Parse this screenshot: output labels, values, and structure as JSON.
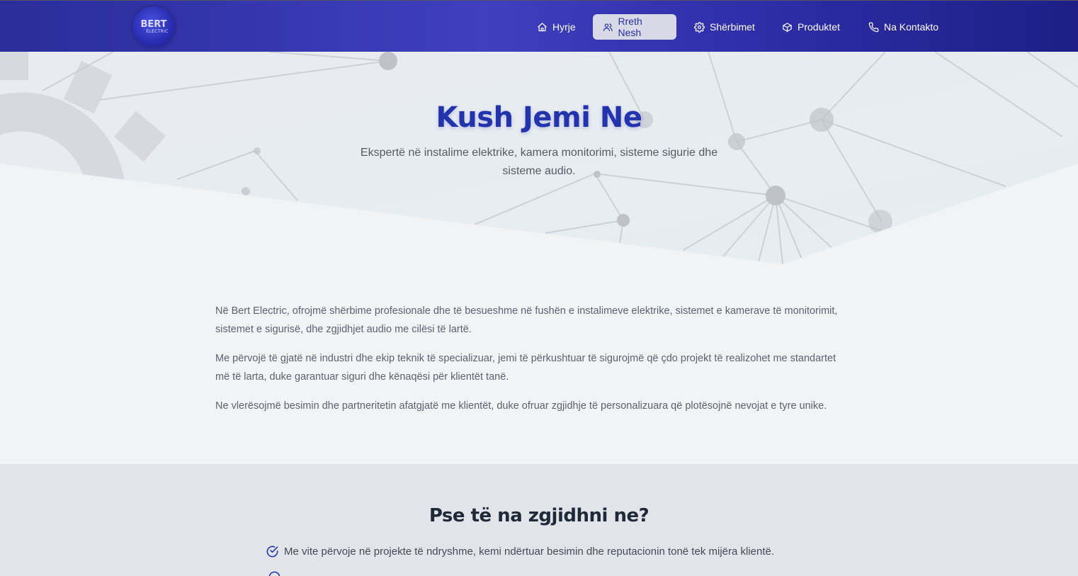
{
  "logo": {
    "line1": "BERT",
    "line2": "ELECTRIC"
  },
  "nav": {
    "items": [
      {
        "label": "Hyrje",
        "icon": "home-icon"
      },
      {
        "label": "Rreth Nesh",
        "icon": "users-icon",
        "active": true
      },
      {
        "label": "Shërbimet",
        "icon": "gear-icon"
      },
      {
        "label": "Produktet",
        "icon": "box-icon"
      },
      {
        "label": "Na Kontakto",
        "icon": "phone-icon"
      }
    ]
  },
  "hero": {
    "title": "Kush Jemi Ne",
    "subtitle": "Ekspertë në instalime elektrike, kamera monitorimi, sisteme sigurie dhe sisteme audio."
  },
  "about": {
    "paragraphs": [
      "Në Bert Electric, ofrojmë shërbime profesionale dhe të besueshme në fushën e instalimeve elektrike, sistemet e kamerave të monitorimit, sistemet e sigurisë, dhe zgjidhjet audio me cilësi të lartë.",
      "Me përvojë të gjatë në industri dhe ekip teknik të specializuar, jemi të përkushtuar të sigurojmë që çdo projekt të realizohet me standartet më të larta, duke garantuar siguri dhe kënaqësi për klientët tanë.",
      "Ne vlerësojmë besimin dhe partneritetin afatgjatë me klientët, duke ofruar zgjidhje të personalizuara që plotësojnë nevojat e tyre unike."
    ]
  },
  "why": {
    "title": "Pse të na zgjidhni ne?",
    "items": [
      "Me vite përvoje në projekte të ndryshme, kemi ndërtuar besimin dhe reputacionin tonë tek mijëra klientë."
    ]
  },
  "colors": {
    "nav_bg": "#3a3ab8",
    "accent": "#2333ad",
    "active_pill": "#d7d9e6",
    "page_bg": "#f2f3f5",
    "section_bg": "#e1e4e9"
  }
}
